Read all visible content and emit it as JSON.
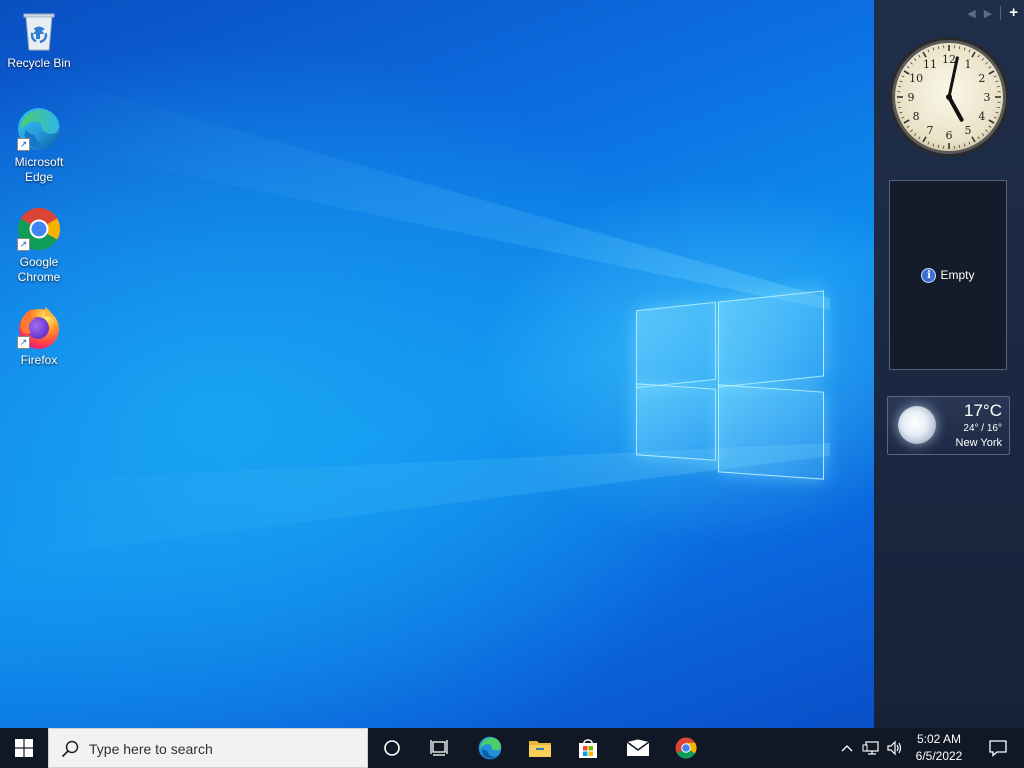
{
  "desktop": {
    "icons": [
      {
        "label": "Recycle Bin",
        "icon": "recycle-bin-icon"
      },
      {
        "label": "Microsoft Edge",
        "icon": "edge-icon"
      },
      {
        "label": "Google Chrome",
        "icon": "chrome-icon"
      },
      {
        "label": "Firefox",
        "icon": "firefox-icon"
      }
    ]
  },
  "sidebar": {
    "nav": {
      "prev": "◀",
      "next": "▶",
      "add": "+"
    },
    "clock": {
      "hour": 5,
      "minute": 2,
      "numerals": [
        "1",
        "2",
        "3",
        "4",
        "5",
        "6",
        "7",
        "8",
        "9",
        "10",
        "11",
        "12"
      ]
    },
    "slideshow": {
      "status": "Empty",
      "info": "i"
    },
    "weather": {
      "temperature": "17°C",
      "range": "24° / 16°",
      "city": "New York",
      "icon": "moon-icon"
    }
  },
  "taskbar": {
    "search_placeholder": "Type here to search",
    "pinned": [
      {
        "name": "cortana",
        "icon": "cortana-icon"
      },
      {
        "name": "task-view",
        "icon": "task-view-icon"
      },
      {
        "name": "edge",
        "icon": "edge-icon"
      },
      {
        "name": "file-explorer",
        "icon": "folder-icon"
      },
      {
        "name": "store",
        "icon": "store-icon"
      },
      {
        "name": "mail",
        "icon": "mail-icon"
      },
      {
        "name": "chrome",
        "icon": "chrome-icon"
      }
    ],
    "clock": {
      "time": "5:02 AM",
      "date": "6/5/2022"
    },
    "tray_icons": [
      "chevron-up-icon",
      "network-icon",
      "volume-icon",
      "notification-icon"
    ]
  },
  "colors": {
    "taskbar": "#101826",
    "sidebar": "#1f2e4a",
    "wallpaper": "#0b5fd1"
  }
}
